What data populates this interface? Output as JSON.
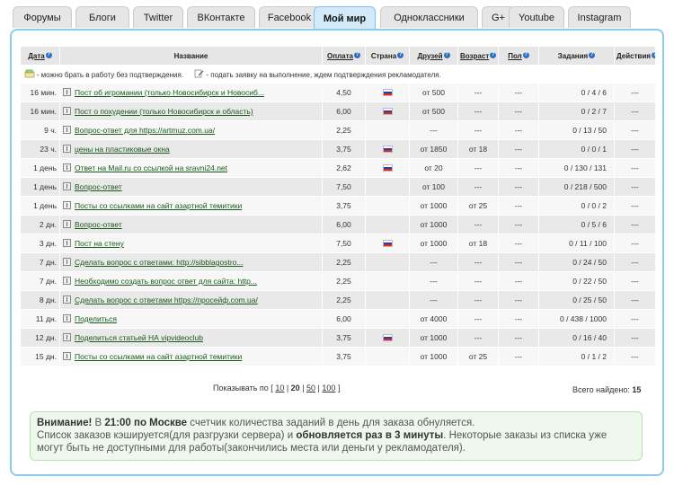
{
  "tabs": [
    {
      "label": "Форумы",
      "active": false
    },
    {
      "label": "Блоги",
      "active": false
    },
    {
      "label": "Twitter",
      "active": false
    },
    {
      "label": "ВКонтакте",
      "active": false
    },
    {
      "label": "Facebook",
      "active": false
    },
    {
      "label": "Мой мир",
      "active": true
    },
    {
      "label": "Одноклассники",
      "active": false
    },
    {
      "label": "G+",
      "active": false
    },
    {
      "label": "Youtube",
      "active": false
    },
    {
      "label": "Instagram",
      "active": false
    }
  ],
  "table": {
    "headers": {
      "date": "Дата",
      "name": "Название",
      "pay": "Оплата",
      "country": "Страна",
      "friends": "Друзей",
      "age": "Возраст",
      "gender": "Пол",
      "tasks": "Задания",
      "actions": "Действия"
    },
    "legend": {
      "no_confirm": "- можно брать в работу без подтверждения.",
      "need_confirm": "- подать заявку на выполнение, ждем подтверждения рекламодателя."
    },
    "rows": [
      {
        "date": "16 мин.",
        "name": "Пост об игромании (только Новосибирск и Новосиб...",
        "pay": "4,50",
        "flag": true,
        "friends": "от 500",
        "age": "---",
        "gender": "---",
        "tasks": "0 / 4 / 6",
        "actions": "---"
      },
      {
        "date": "16 мин.",
        "name": "Пост о похудении (только Новосибирск и область)",
        "pay": "6,00",
        "flag": true,
        "friends": "от 500",
        "age": "---",
        "gender": "---",
        "tasks": "0 / 2 / 7",
        "actions": "---"
      },
      {
        "date": "9 ч.",
        "name": "Вопрос-ответ для https://artmuz.com.ua/",
        "pay": "2,25",
        "flag": false,
        "friends": "---",
        "age": "---",
        "gender": "---",
        "tasks": "0 / 13 / 50",
        "actions": "---"
      },
      {
        "date": "23 ч.",
        "name": "цены на пластиковые окна",
        "pay": "3,75",
        "flag": true,
        "friends": "от 1850",
        "age": "от 18",
        "gender": "---",
        "tasks": "0 / 0 / 1",
        "actions": "---"
      },
      {
        "date": "1 день",
        "name": "Ответ на Mail.ru со ссылкой на sravni24.net",
        "pay": "2,62",
        "flag": true,
        "friends": "от 20",
        "age": "---",
        "gender": "---",
        "tasks": "0 / 130 / 131",
        "actions": "---"
      },
      {
        "date": "1 день",
        "name": "Вопрос-ответ",
        "pay": "7,50",
        "flag": false,
        "friends": "от 100",
        "age": "---",
        "gender": "---",
        "tasks": "0 / 218 / 500",
        "actions": "---"
      },
      {
        "date": "1 день",
        "name": "Посты со ссылками на сайт азартной темитики",
        "pay": "3,75",
        "flag": false,
        "friends": "от 1000",
        "age": "от 25",
        "gender": "---",
        "tasks": "0 / 0 / 2",
        "actions": "---"
      },
      {
        "date": "2 дн.",
        "name": "Вопрос-ответ",
        "pay": "6,00",
        "flag": false,
        "friends": "от 1000",
        "age": "---",
        "gender": "---",
        "tasks": "0 / 5 / 6",
        "actions": "---"
      },
      {
        "date": "3 дн.",
        "name": "Пост на стену",
        "pay": "7,50",
        "flag": true,
        "friends": "от 1000",
        "age": "от 18",
        "gender": "---",
        "tasks": "0 / 11 / 100",
        "actions": "---"
      },
      {
        "date": "7 дн.",
        "name": "Сделать вопрос с ответами: http://sibblagostro...",
        "pay": "2,25",
        "flag": false,
        "friends": "---",
        "age": "---",
        "gender": "---",
        "tasks": "0 / 24 / 50",
        "actions": "---"
      },
      {
        "date": "7 дн.",
        "name": "Необходимо создать вопрос ответ для сайта: http...",
        "pay": "2,25",
        "flag": false,
        "friends": "---",
        "age": "---",
        "gender": "---",
        "tasks": "0 / 22 / 50",
        "actions": "---"
      },
      {
        "date": "8 дн.",
        "name": "Сделать вопрос с ответами https://просейф.com.ua/",
        "pay": "2,25",
        "flag": false,
        "friends": "---",
        "age": "---",
        "gender": "---",
        "tasks": "0 / 25 / 50",
        "actions": "---"
      },
      {
        "date": "11 дн.",
        "name": "Поделиться",
        "pay": "6,00",
        "flag": false,
        "friends": "от 4000",
        "age": "---",
        "gender": "---",
        "tasks": "0 / 438 / 1000",
        "actions": "---"
      },
      {
        "date": "12 дн.",
        "name": "Поделиться статьей НА vipvideoclub",
        "pay": "3,75",
        "flag": true,
        "friends": "от 1000",
        "age": "---",
        "gender": "---",
        "tasks": "0 / 16 / 40",
        "actions": "---"
      },
      {
        "date": "15 дн.",
        "name": "Посты со ссылками на сайт азартной темитики",
        "pay": "3,75",
        "flag": false,
        "friends": "от 1000",
        "age": "от 25",
        "gender": "---",
        "tasks": "0 / 1 / 2",
        "actions": "---"
      }
    ]
  },
  "paging": {
    "label": "Показывать по [",
    "options": [
      "10",
      "20",
      "50",
      "100"
    ],
    "selected": "20",
    "close": "]"
  },
  "found": {
    "label": "Всего найдено:",
    "value": "15"
  },
  "notice": {
    "attention": "Внимание!",
    "p1": " В ",
    "time": "21:00 по Москве",
    "p2": " счетчик количества заданий в день для заказа обнуляется.",
    "p3": "Список заказов кэшируется(для разгрузки сервера) и ",
    "refresh": "обновляется раз в 3 минуты",
    "p4": ". Некоторые заказы из списка уже могут быть не доступными для работы(закончились места или деньги у рекламодателя)."
  }
}
